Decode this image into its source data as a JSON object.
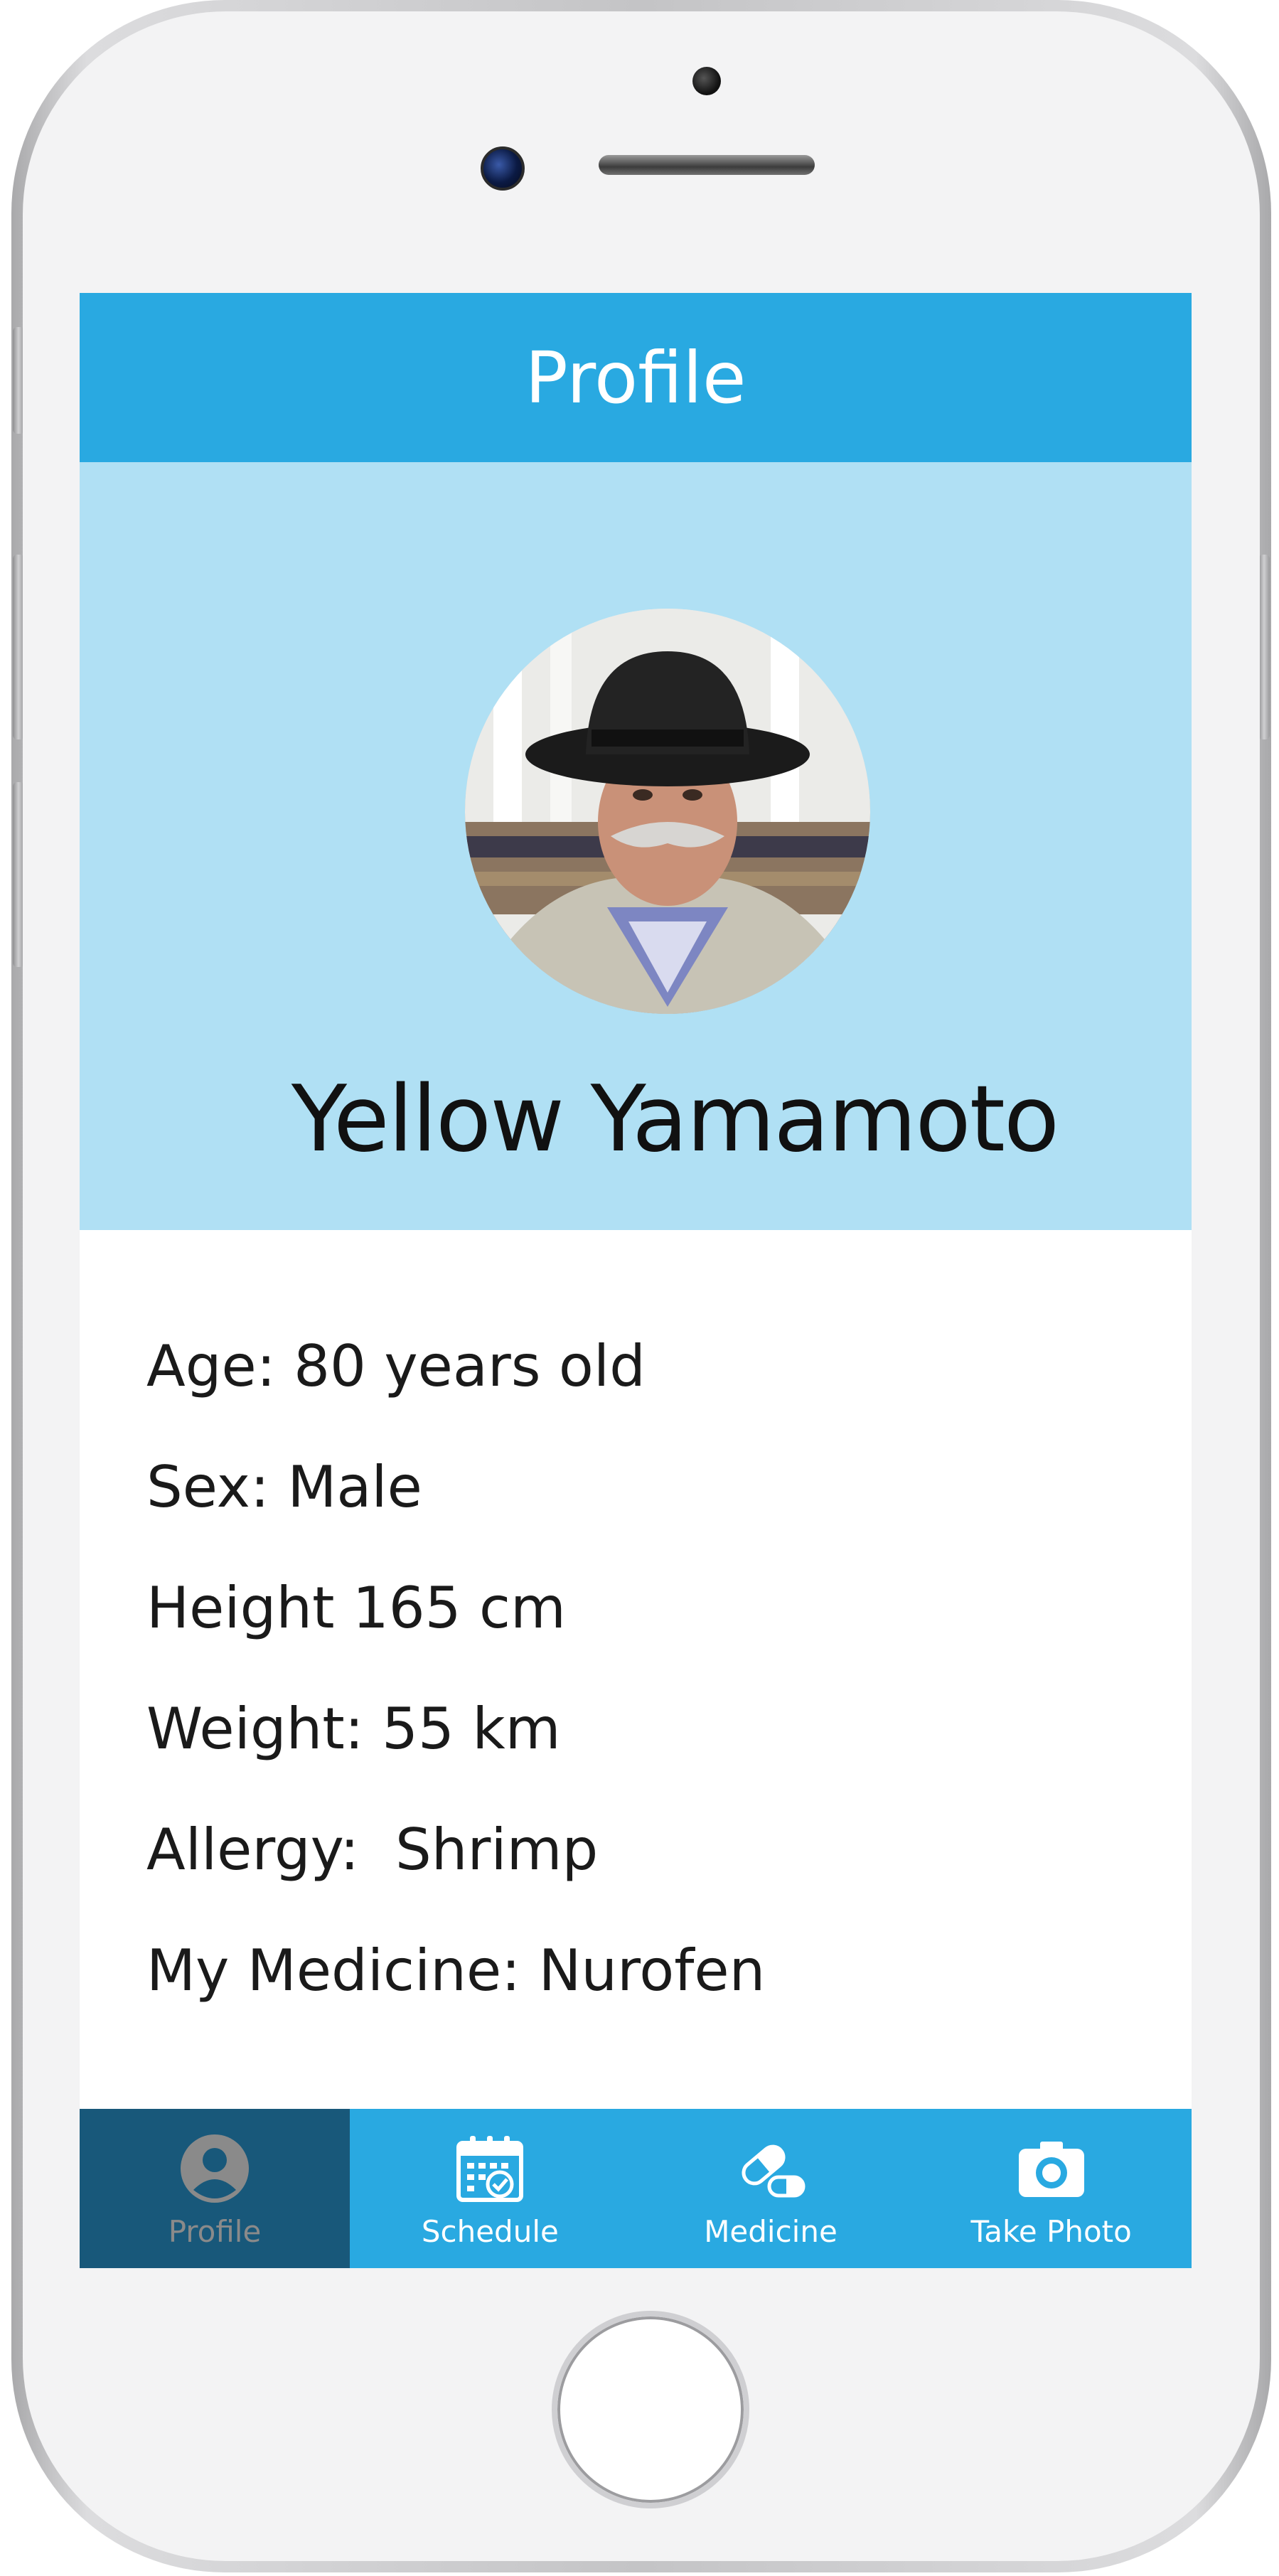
{
  "header": {
    "title": "Profile"
  },
  "profile": {
    "name": "Yellow Yamamoto",
    "details": [
      "Age: 80 years old",
      "Sex: Male",
      "Height 165 cm",
      "Weight: 55 km",
      "Allergy:  Shrimp",
      "My Medicine: Nurofen"
    ]
  },
  "tabbar": {
    "tabs": [
      {
        "label": "Profile",
        "icon": "user-circle-icon",
        "active": true
      },
      {
        "label": "Schedule",
        "icon": "calendar-check-icon",
        "active": false
      },
      {
        "label": "Medicine",
        "icon": "pill-icon",
        "active": false
      },
      {
        "label": "Take Photo",
        "icon": "camera-icon",
        "active": false
      }
    ]
  },
  "colors": {
    "primary": "#29a9e1",
    "hero_background": "#b0e0f4",
    "active_tab": "#18587a"
  }
}
